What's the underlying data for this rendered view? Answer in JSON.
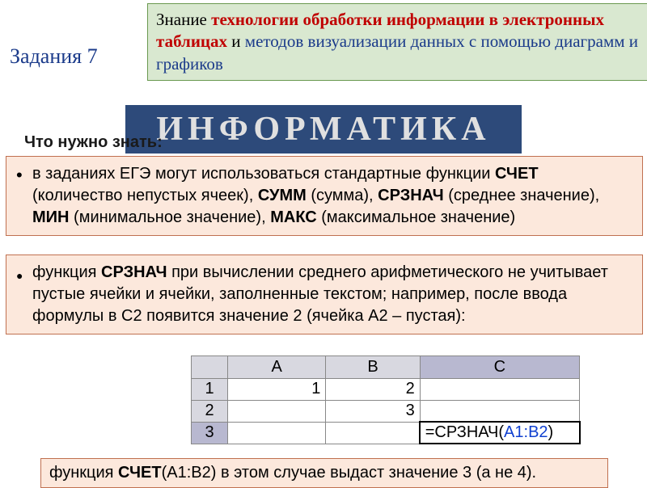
{
  "taskTitle": "Задания 7",
  "callout": {
    "p1": "Знание ",
    "p2": "технологии обработки информации в электронных таблицах",
    "p3": " и ",
    "p4": "методов визуализации данных с помощью диаграмм и графиков"
  },
  "bgBanner": "ИНФОРМАТИКА",
  "subtitle": "Что нужно знать:",
  "block1": {
    "t1": " в заданиях ЕГЭ могут использоваться стандартные функции ",
    "f1": "СЧЕТ",
    "t2": " (количество непустых ячеек), ",
    "f2": "СУММ",
    "t3": " (сумма), ",
    "f3": "СРЗНАЧ",
    "t4": " (среднее значение), ",
    "f4": "МИН",
    "t5": " (минимальное значение), ",
    "f5": "МАКС",
    "t6": " (максимальное значение)"
  },
  "block2": {
    "t1": " функция ",
    "f1": "СРЗНАЧ",
    "t2": " при вычислении среднего арифметического не учитывает пустые ячейки и ячейки, заполненные текстом; например, после ввода формулы в C2 появится значение 2 (ячейка А2 – пустая):"
  },
  "sheet": {
    "cols": {
      "A": "A",
      "B": "B",
      "C": "C"
    },
    "rows": {
      "r1": "1",
      "r2": "2",
      "r3": "3"
    },
    "cells": {
      "A1": "1",
      "B1": "2",
      "A2": "",
      "B2": "3",
      "C3_eq": "=СРЗНАЧ(",
      "C3_rng": "A1:B2",
      "C3_close": ")"
    }
  },
  "block3": {
    "t1": "функция ",
    "f1": "СЧЕТ",
    "t2": "(A1:B2) в этом случае выдаст значение 3 (а не 4)."
  }
}
